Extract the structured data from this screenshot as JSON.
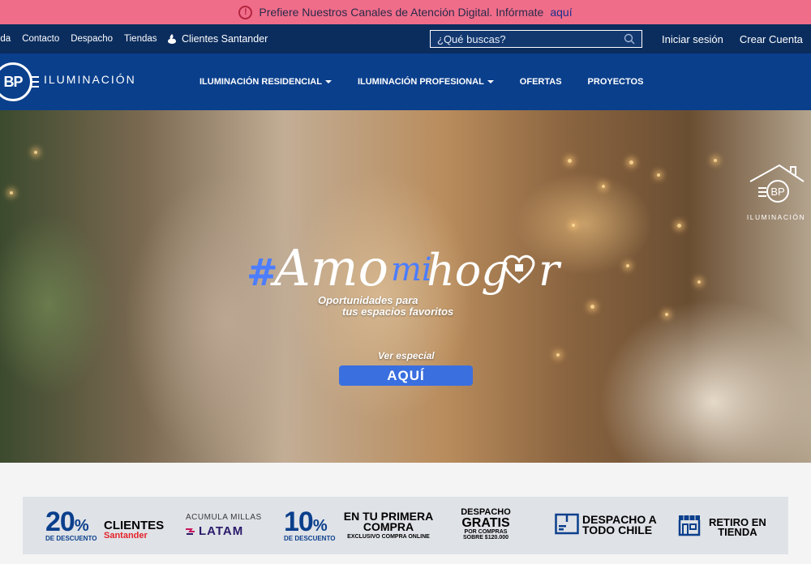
{
  "alert": {
    "icon": "exclamation-circle-icon",
    "message": "Prefiere Nuestros Canales de Atención Digital. Infórmate",
    "link": "aquí"
  },
  "utility": {
    "links": [
      "uda",
      "Contacto",
      "Despacho",
      "Tiendas"
    ],
    "santander_label": "Clientes Santander",
    "search_placeholder": "¿Qué buscas?",
    "login": "Iniciar sesión",
    "register": "Crear Cuenta"
  },
  "nav": {
    "logo_mark": "BP",
    "logo_text": "ILUMINACIÓN",
    "items": [
      {
        "label": "ILUMINACIÓN RESIDENCIAL",
        "dropdown": true
      },
      {
        "label": "ILUMINACIÓN PROFESIONAL",
        "dropdown": true
      },
      {
        "label": "OFERTAS",
        "dropdown": false
      },
      {
        "label": "PROYECTOS",
        "dropdown": false
      }
    ]
  },
  "hero": {
    "watermark_mark": "BP",
    "watermark_text": "ILUMINACIÓN",
    "title_hash": "#",
    "title_a": "Amo",
    "title_b": "mi",
    "title_c": "hog",
    "title_d": "r",
    "subtitle_line1": "Oportunidades para",
    "subtitle_line2": "tus espacios favoritos",
    "ver": "Ver especial",
    "cta": "AQUÍ"
  },
  "benefits": {
    "santander_pct": "20",
    "santander_pct_sign": "%",
    "santander_sub": "DE DESCUENTO",
    "santander_clientes": "CLIENTES",
    "santander_brand": "Santander",
    "latam_top": "ACUMULA MILLAS",
    "latam_brand": "LATAM",
    "first_pct": "10",
    "first_pct_sign": "%",
    "first_sub": "DE DESCUENTO",
    "first_title_1": "EN TU PRIMERA",
    "first_title_2": "COMPRA",
    "first_excl": "EXCLUSIVO COMPRA ONLINE",
    "free_l1": "DESPACHO",
    "free_l2": "GRATIS",
    "free_l3": "POR COMPRAS",
    "free_l4": "SOBRE $120.000",
    "chile_1": "DESPACHO A",
    "chile_2": "TODO CHILE",
    "retiro_1": "RETIRO EN",
    "retiro_2": "TIENDA"
  },
  "colors": {
    "alert_bg": "#f06d8a",
    "util_bg": "#0b2d5e",
    "nav_bg": "#0a3f8c",
    "cta_bg": "#3a6fe0",
    "brand_blue": "#0a3f8c",
    "santander_red": "#e4232a"
  }
}
